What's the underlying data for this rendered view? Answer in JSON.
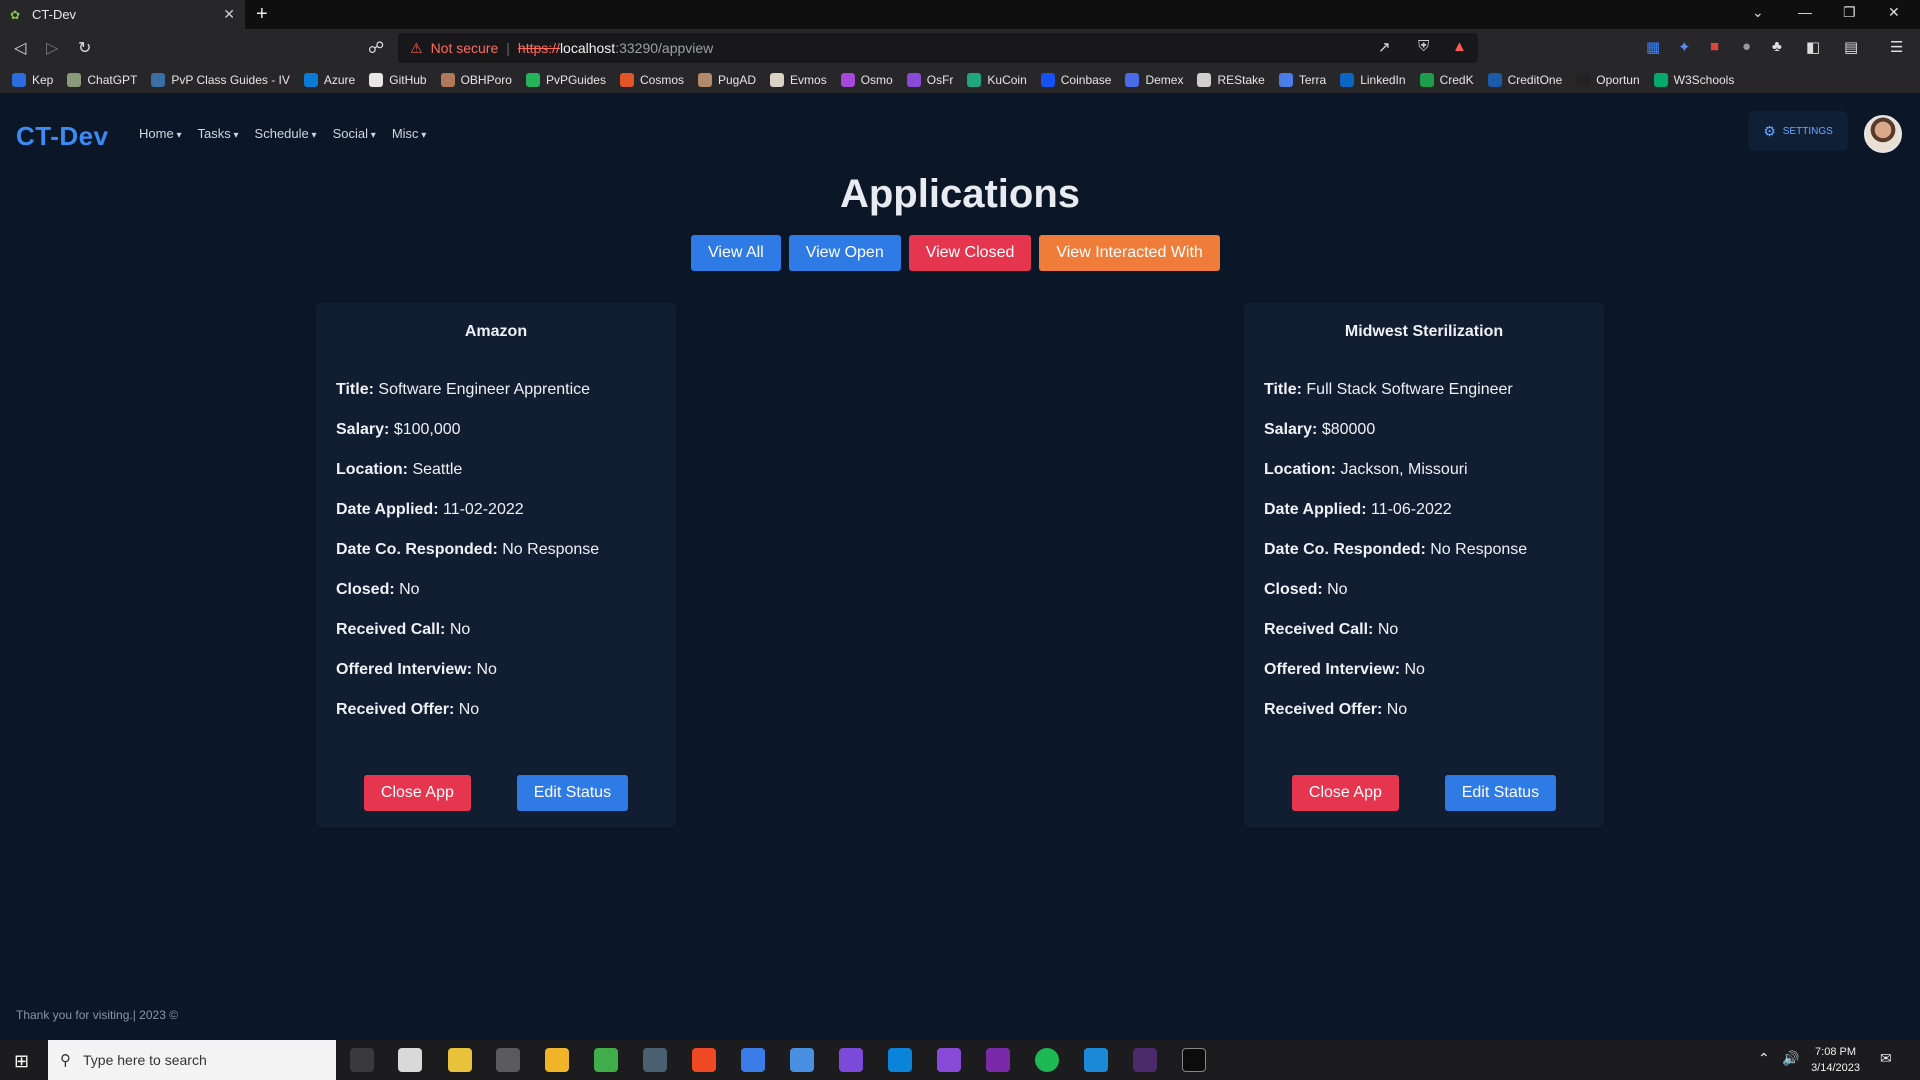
{
  "browser": {
    "tab_title": "CT-Dev",
    "url_warning": "Not secure",
    "url_scheme": "https://",
    "url_host": "localhost",
    "url_path": ":33290/appview",
    "bookmarks": [
      {
        "label": "Kep",
        "color": "#2d6cdf"
      },
      {
        "label": "ChatGPT",
        "color": "#8a9a7a"
      },
      {
        "label": "PvP Class Guides - IV",
        "color": "#3a6ea5"
      },
      {
        "label": "Azure",
        "color": "#0a7cd8"
      },
      {
        "label": "GitHub",
        "color": "#e6e6e6"
      },
      {
        "label": "OBHPoro",
        "color": "#b0785a"
      },
      {
        "label": "PvPGuides",
        "color": "#24b35a"
      },
      {
        "label": "Cosmos",
        "color": "#e25528"
      },
      {
        "label": "PugAD",
        "color": "#b08a6a"
      },
      {
        "label": "Evmos",
        "color": "#d9d2c5"
      },
      {
        "label": "Osmo",
        "color": "#a54ad8"
      },
      {
        "label": "OsFr",
        "color": "#8a4ad8"
      },
      {
        "label": "KuCoin",
        "color": "#1fa67a"
      },
      {
        "label": "Coinbase",
        "color": "#1652f0"
      },
      {
        "label": "Demex",
        "color": "#4a6ae8"
      },
      {
        "label": "REStake",
        "color": "#cfcfcf"
      },
      {
        "label": "Terra",
        "color": "#4a7de8"
      },
      {
        "label": "LinkedIn",
        "color": "#0a66c2"
      },
      {
        "label": "CredK",
        "color": "#1e9e4a"
      },
      {
        "label": "CreditOne",
        "color": "#1a5aa8"
      },
      {
        "label": "Oportun",
        "color": "#222222"
      },
      {
        "label": "W3Schools",
        "color": "#04aa6d"
      }
    ]
  },
  "nav": {
    "brand": "CT-Dev",
    "menu": [
      "Home",
      "Tasks",
      "Schedule",
      "Social",
      "Misc"
    ],
    "settings_label": "SETTINGS"
  },
  "page": {
    "title": "Applications",
    "filters": {
      "view_all": "View All",
      "view_open": "View Open",
      "view_closed": "View Closed",
      "view_interacted": "View Interacted With"
    }
  },
  "labels": {
    "title": "Title:",
    "salary": "Salary:",
    "location": "Location:",
    "date_applied": "Date Applied:",
    "date_responded": "Date Co. Responded:",
    "closed": "Closed:",
    "received_call": "Received Call:",
    "offered_interview": "Offered Interview:",
    "received_offer": "Received Offer:",
    "close_app": "Close App",
    "edit_status": "Edit Status"
  },
  "applications": [
    {
      "company": "Amazon",
      "title": "Software Engineer Apprentice",
      "salary": "$100,000",
      "location": "Seattle",
      "date_applied": "11-02-2022",
      "date_responded": "No Response",
      "closed": "No",
      "received_call": "No",
      "offered_interview": "No",
      "received_offer": "No"
    },
    {
      "company": "Midwest Sterilization",
      "title": "Full Stack Software Engineer",
      "salary": "$80000",
      "location": "Jackson, Missouri",
      "date_applied": "11-06-2022",
      "date_responded": "No Response",
      "closed": "No",
      "received_call": "No",
      "offered_interview": "No",
      "received_offer": "No"
    }
  ],
  "footer": "Thank you for visiting.| 2023 ©",
  "taskbar": {
    "search_placeholder": "Type here to search",
    "time": "7:08 PM",
    "date": "3/14/2023"
  }
}
